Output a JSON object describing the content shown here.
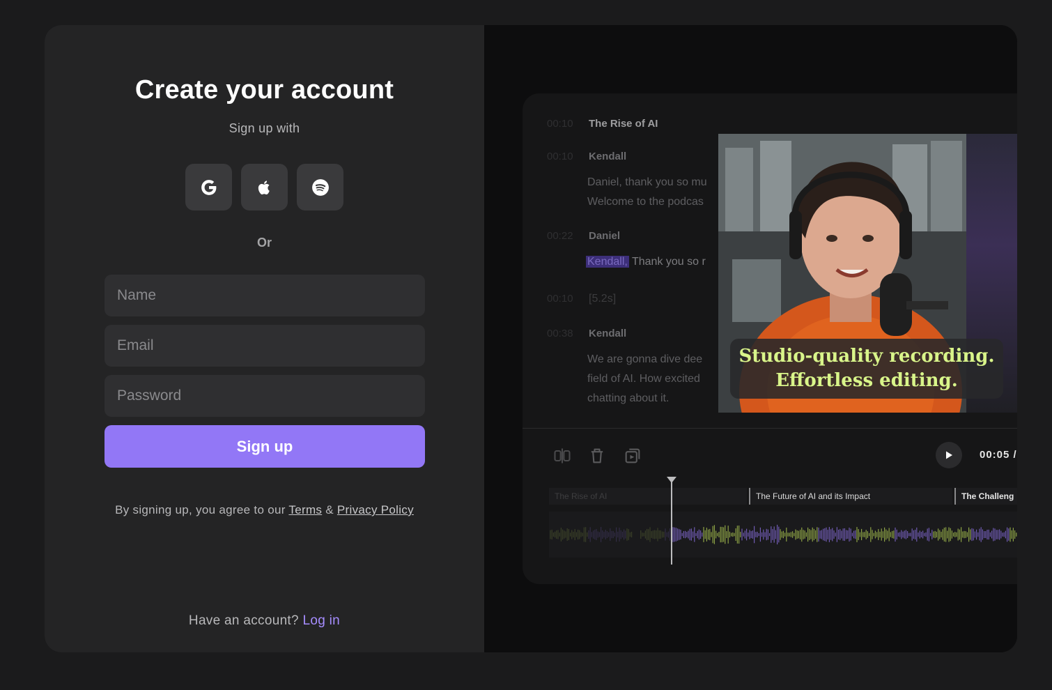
{
  "signup": {
    "title": "Create your account",
    "subtitle": "Sign up with",
    "social": [
      {
        "name": "google",
        "icon": "google-icon"
      },
      {
        "name": "apple",
        "icon": "apple-icon"
      },
      {
        "name": "spotify",
        "icon": "spotify-icon"
      }
    ],
    "or_label": "Or",
    "name_placeholder": "Name",
    "email_placeholder": "Email",
    "password_placeholder": "Password",
    "submit_label": "Sign up",
    "agree_prefix": "By signing up, you agree to our",
    "terms_label": "Terms",
    "amp": "&",
    "privacy_label": "Privacy Policy",
    "have_account": "Have an account?",
    "login_label": "Log in"
  },
  "preview": {
    "transcript": {
      "heading_ts": "00:10",
      "heading": "The Rise of AI",
      "rows": [
        {
          "ts": "00:10",
          "speaker": "Kendall",
          "lines": [
            "Daniel, thank you so mu",
            "Welcome to the podcas"
          ]
        },
        {
          "ts": "00:22",
          "speaker": "Daniel",
          "highlight": "Kendall,",
          "lines": [
            "Thank you so r"
          ]
        },
        {
          "ts": "00:10",
          "gap": "[5.2s]"
        },
        {
          "ts": "00:38",
          "speaker": "Kendall",
          "lines": [
            "We are gonna dive dee",
            "field of AI. How excited",
            "chatting about it."
          ]
        }
      ]
    },
    "caption_line1": "Studio-quality recording.",
    "caption_line2": "Effortless editing.",
    "time": "00:05 /",
    "chapters": [
      "The Rise of AI",
      "The Future of AI and its Impact",
      "The Challeng"
    ],
    "colors": {
      "accent": "#9277f6",
      "caption": "#d9f58a",
      "wave_green": "#9ab34a",
      "wave_purple": "#7a63c4"
    }
  }
}
